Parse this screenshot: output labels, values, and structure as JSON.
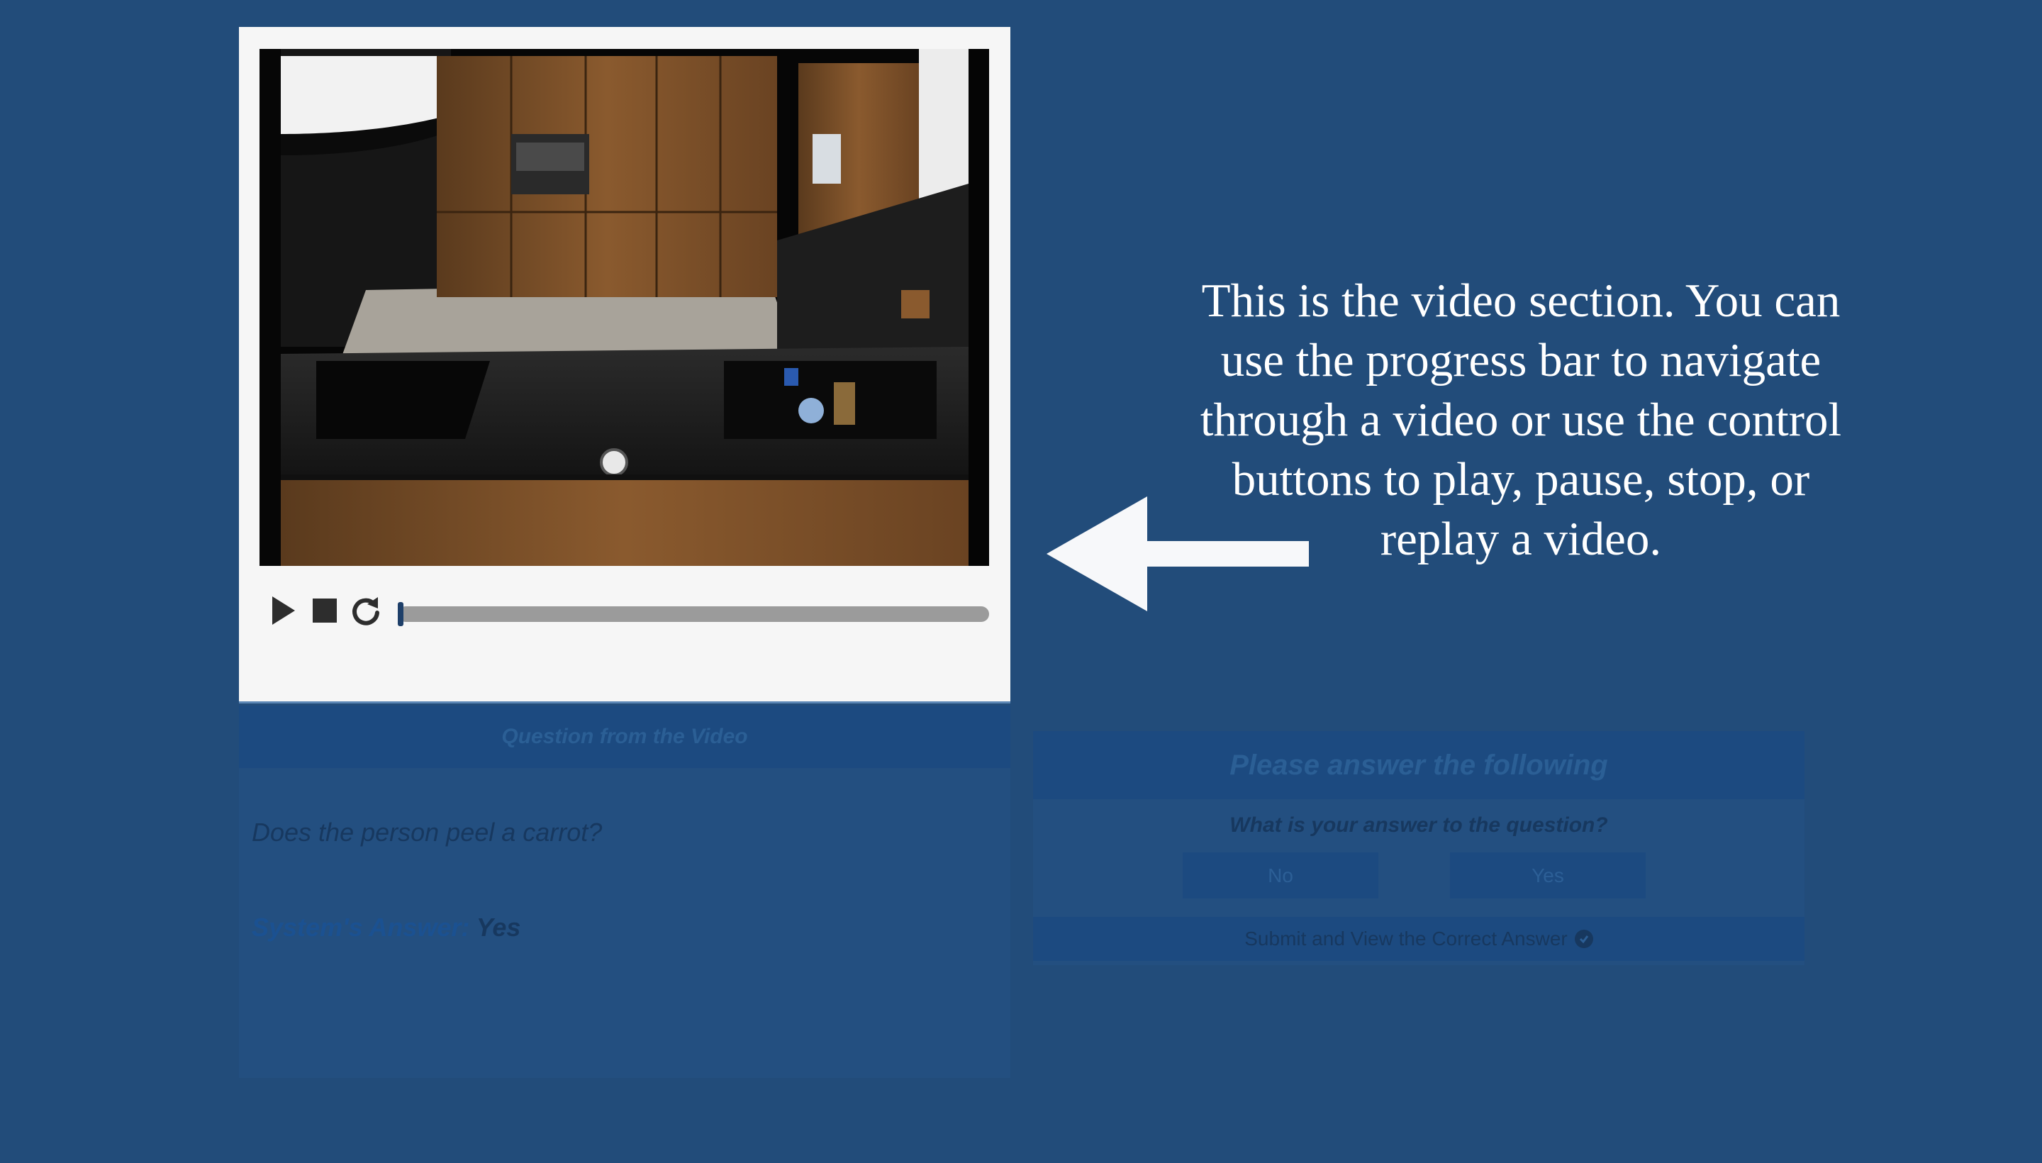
{
  "video": {
    "controls": {
      "play_icon": "play-icon",
      "stop_icon": "stop-icon",
      "replay_icon": "replay-icon"
    },
    "progress": 0.0
  },
  "callout": {
    "text": "This is the video section. You can use the progress bar to navigate through a video or use the control buttons to play, pause, stop, or replay a video.",
    "arrow_icon": "arrow-left-icon"
  },
  "question_panel": {
    "header": "Question from the Video",
    "question": "Does the person peel a carrot?",
    "system_answer_label": "System's Answer:",
    "system_answer_value": "Yes"
  },
  "answer_panel": {
    "header": "Please answer the following",
    "prompt": "What is your answer to the question?",
    "options": [
      "No",
      "Yes"
    ],
    "submit_label": "Submit and View the Correct Answer"
  },
  "colors": {
    "background": "#224c7a",
    "panel": "#f6f6f6",
    "header_dim": "#1c4a80",
    "handle": "#1e3f69"
  }
}
